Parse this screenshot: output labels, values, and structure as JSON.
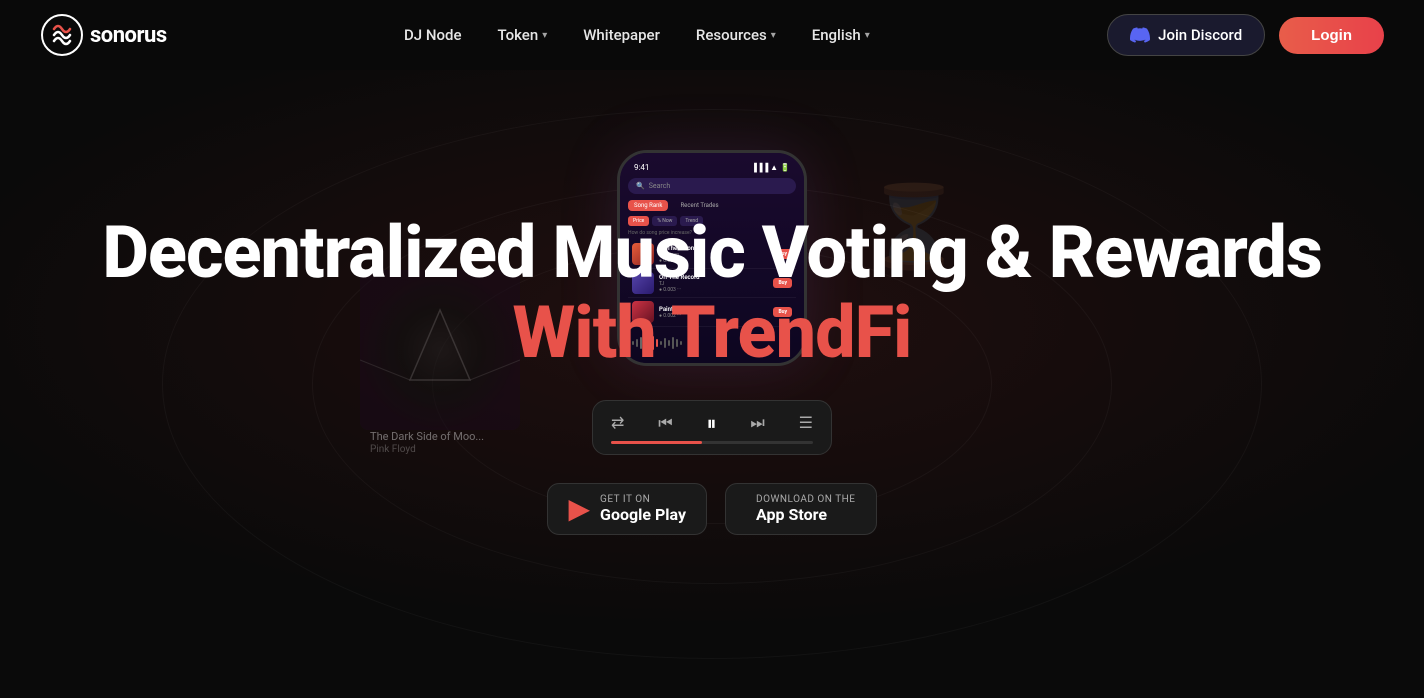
{
  "meta": {
    "title": "Sonorus - Decentralized Music Voting & Rewards"
  },
  "nav": {
    "logo_alt": "Sonorus",
    "links": [
      {
        "label": "DJ Node",
        "has_arrow": false
      },
      {
        "label": "Token",
        "has_arrow": true
      },
      {
        "label": "Whitepaper",
        "has_arrow": false
      },
      {
        "label": "Resources",
        "has_arrow": true
      },
      {
        "label": "English",
        "has_arrow": true
      }
    ],
    "discord_label": "Join Discord",
    "login_label": "Login"
  },
  "hero": {
    "headline_line1": "Decentralized",
    "headline_line2": "Music Voting & Rewards",
    "headline_trendfi": "With TrendFi"
  },
  "phone": {
    "time": "9:41",
    "search_placeholder": "Search",
    "tab_song_rank": "Song Rank",
    "tab_recent_trades": "Recent Trades",
    "filter_price": "Price",
    "filter_now": "% Now",
    "filter_trend": "Trend",
    "hint": "How do song price increase?",
    "tracks": [
      {
        "name": "To The Moon",
        "artist": "Hooligan",
        "price": "0.004",
        "color": "#e85d3a"
      },
      {
        "name": "Off The Record",
        "artist": "TJ",
        "price": "0.003",
        "color": "#5544aa"
      },
      {
        "name": "Paint The Town Red",
        "artist": "",
        "price": "0.002",
        "color": "#aa3344"
      }
    ]
  },
  "player": {
    "progress_pct": 45,
    "controls": [
      "shuffle",
      "prev",
      "pause",
      "next",
      "list"
    ]
  },
  "badges": [
    {
      "id": "google-play",
      "sub_label": "GET IT ON",
      "main_label": "Google Play",
      "icon": "▶"
    },
    {
      "id": "app-store",
      "sub_label": "Download on the",
      "main_label": "App Store",
      "icon": ""
    }
  ],
  "album": {
    "title": "The Dark Side of Moo...",
    "artist": "Pink Floyd"
  }
}
